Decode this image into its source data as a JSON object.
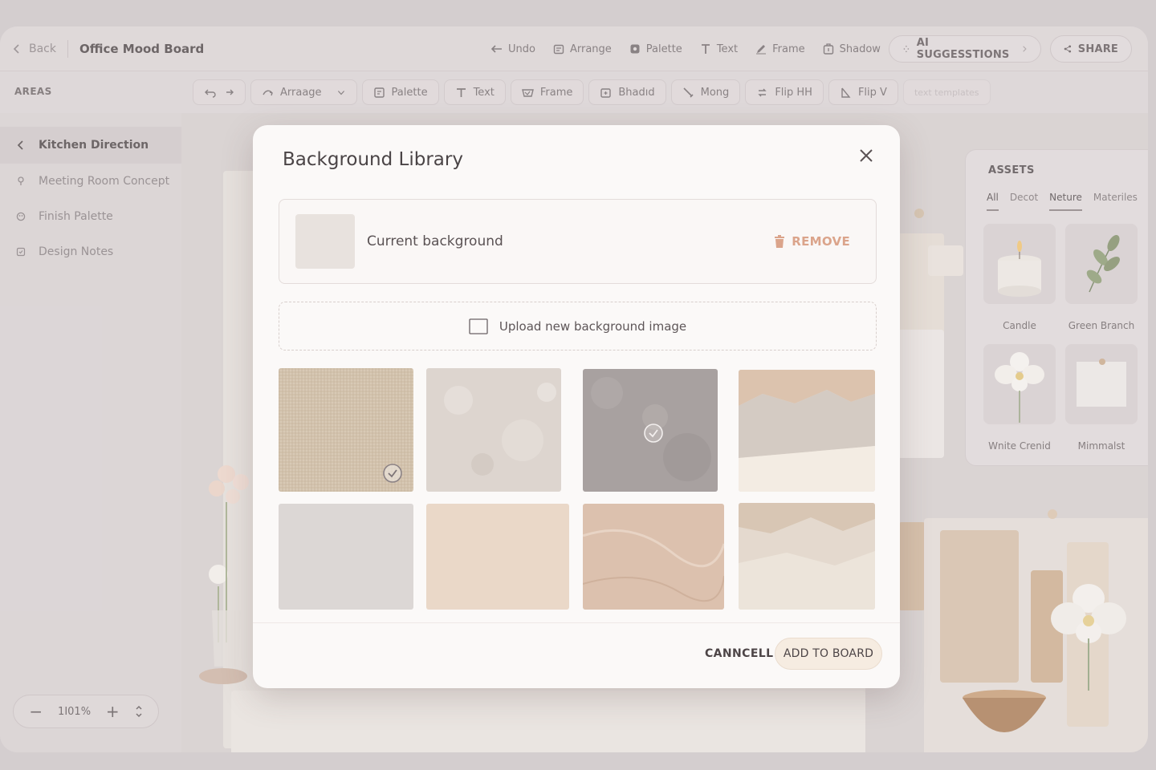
{
  "header": {
    "back_label": "Back",
    "board_title": "Office Mood Board",
    "actions": [
      "Undo",
      "Arrange",
      "Palette",
      "Text",
      "Frame",
      "Shadow"
    ],
    "ai_label": "AI SUGGESSTIONS",
    "share_label": "SHARE"
  },
  "toolbar": {
    "areas_label": "AREAS",
    "tools": [
      "Arraage",
      "Palette",
      "Text",
      "Frame",
      "Bhadıd",
      "Mong",
      "Flip HH",
      "Flip V"
    ],
    "ghost_tool": "text templates"
  },
  "sidebar": {
    "items": [
      "Kitchen Direction",
      "Meeting Room Concept",
      "Finish Palette",
      "Design Notes"
    ]
  },
  "zoom": {
    "minus": "−",
    "value": "1I01%",
    "plus": "+"
  },
  "assets": {
    "title": "ASSETS",
    "tabs": [
      "All",
      "Decot",
      "Neture",
      "Materiles"
    ],
    "items": [
      "Candle",
      "Green Branch",
      "Wnite Crenid",
      "Mimmalst"
    ]
  },
  "modal": {
    "title": "Background Library",
    "current_label": "Current background",
    "remove_label": "REMOVE",
    "upload_label": "Upload new background image",
    "cancel_label": "CANNCELL",
    "add_label": "ADD TO BOARD"
  },
  "textures": [
    {
      "name": "linen",
      "color": "#d8c9b5",
      "selected": true
    },
    {
      "name": "plaster",
      "color": "#ddd5cf",
      "selected": false
    },
    {
      "name": "concrete",
      "color": "#a8a1a0",
      "selected": true
    },
    {
      "name": "torn-paper",
      "color": "#e7dcd2",
      "selected": false
    },
    {
      "name": "grey-paper",
      "color": "#dcd7d5",
      "selected": false
    },
    {
      "name": "peach-paper",
      "color": "#ead8c8",
      "selected": false
    },
    {
      "name": "marble",
      "color": "#dcc1ae",
      "selected": false
    },
    {
      "name": "torn-beige",
      "color": "#e4d9ce",
      "selected": false
    }
  ],
  "colors": {
    "accent_remove": "#dba48b",
    "modal_bg": "#fbf9f8"
  }
}
